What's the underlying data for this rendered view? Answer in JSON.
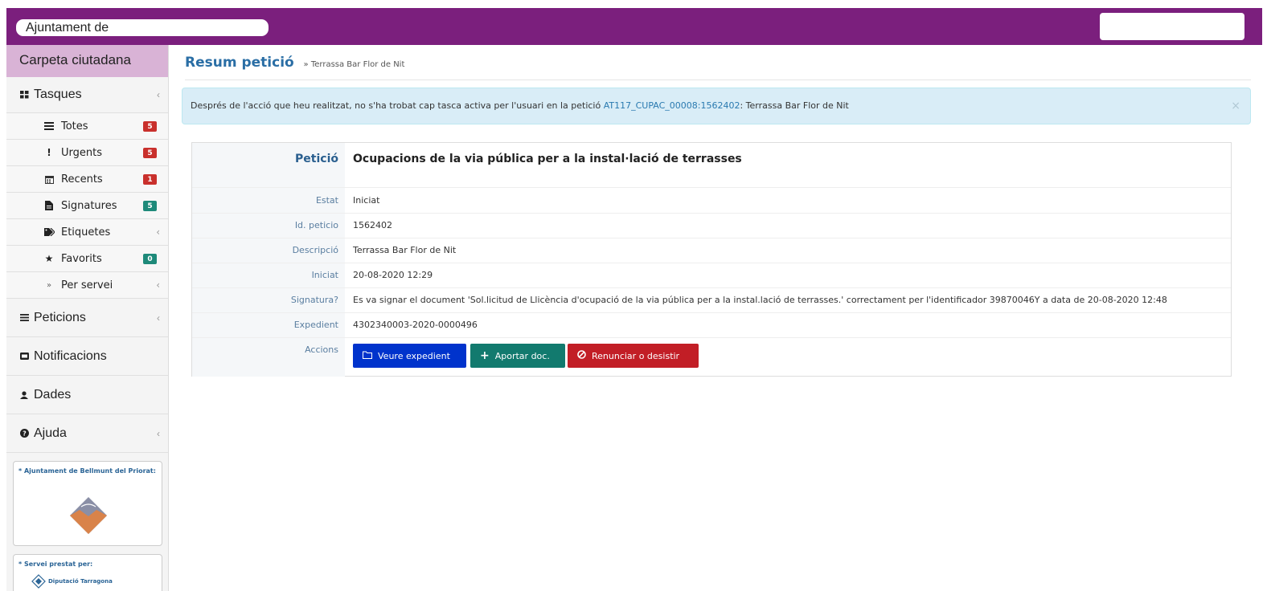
{
  "header": {
    "org_name": "Ajuntament de"
  },
  "sidebar": {
    "title": "Carpeta ciutadana",
    "tasques": {
      "label": "Tasques",
      "items": [
        {
          "label": "Totes",
          "badge": "5",
          "icon": "list-icon"
        },
        {
          "label": "Urgents",
          "badge": "5",
          "icon": "exclamation-icon"
        },
        {
          "label": "Recents",
          "badge": "1",
          "icon": "calendar-icon"
        },
        {
          "label": "Signatures",
          "badge": "5",
          "icon": "file-icon"
        },
        {
          "label": "Etiquetes",
          "icon": "tags-icon"
        },
        {
          "label": "Favorits",
          "badge": "0",
          "icon": "star-icon"
        },
        {
          "label": "Per servei",
          "icon": "double-chevron-icon"
        }
      ]
    },
    "peticions": "Peticions",
    "notificacions": "Notificacions",
    "dades": "Dades",
    "ajuda": "Ajuda",
    "card1_title": "* Ajuntament de Bellmunt del Priorat:",
    "card2_title": "* Servei prestat per:",
    "card2_logo_text": "Diputació Tarragona"
  },
  "main": {
    "title": "Resum petició",
    "breadcrumb": "» Terrassa Bar Flor de Nit",
    "alert": {
      "prefix": "Després de l'acció que heu realitzat, no s'ha trobat cap tasca activa per l'usuari en la petició ",
      "link": "AT117_CUPAC_00008:1562402",
      "suffix": ": Terrassa Bar Flor de Nit",
      "close": "×"
    },
    "detail": {
      "peticio_label": "Petició",
      "peticio_value": "Ocupacions de la via pública per a la instal·lació de terrasses",
      "estat_label": "Estat",
      "estat_value": "Iniciat",
      "id_label": "Id. peticio",
      "id_value": "1562402",
      "descripcio_label": "Descripció",
      "descripcio_value": "Terrassa Bar Flor de Nit",
      "iniciat_label": "Iniciat",
      "iniciat_value": "20-08-2020 12:29",
      "signatura_label": "Signatura?",
      "signatura_value": "Es va signar el document 'Sol.licitud de Llicència d'ocupació de la via pública per a la instal.lació de terrasses.' correctament per l'identificador 39870046Y a data de 20-08-2020 12:48",
      "expedient_label": "Expedient",
      "expedient_value": "4302340003-2020-0000496",
      "accions_label": "Accions"
    },
    "actions": {
      "veure": "Veure expedient",
      "aportar": "Aportar doc.",
      "renunciar": "Renunciar o desistir"
    }
  },
  "colors": {
    "header_purple": "#7b1f7d",
    "sidebar_head": "#d9b3d6",
    "btn_blue": "#0033cc",
    "btn_teal": "#127a6e",
    "btn_red": "#c21e26"
  }
}
